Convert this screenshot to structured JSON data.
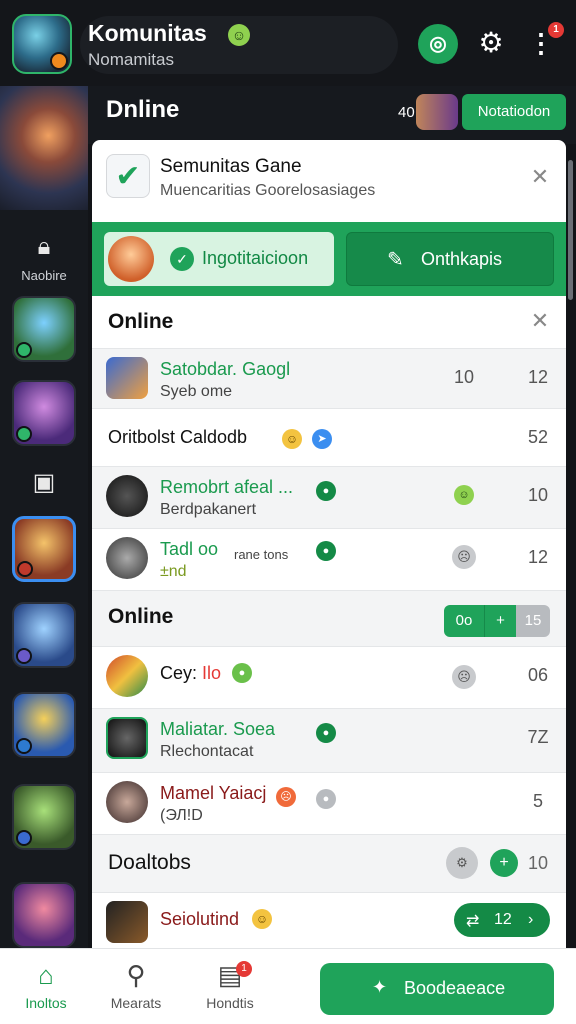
{
  "header": {
    "title": "Komunitas",
    "subtitle": "Nomamitas",
    "smile_icon": "smile-icon",
    "more_badge": "1"
  },
  "online_strip": {
    "label": "Dnline",
    "count": "40",
    "button": "Notatiodon"
  },
  "sidebar": {
    "label1": "Naobire"
  },
  "community_card": {
    "title": "Semunitas Gane",
    "subtitle": "Muencaritias Goorelosasiages"
  },
  "tabs": {
    "left": "Ingotitaicioon",
    "right": "Onthkapis"
  },
  "section1": {
    "title": "Online"
  },
  "rows1": [
    {
      "name": "Satobdar. Gaogl",
      "sub": "Syeb ome",
      "c1": "10",
      "c2": "12"
    },
    {
      "name": "Oritbolst Caldodb",
      "c2": "52"
    },
    {
      "name": "Remobrt afeal ...",
      "sub": "Berdpakanert",
      "c2": "10"
    },
    {
      "name": "Tadl oo",
      "sub": "±nd",
      "extra": "rane tons",
      "c2": "12"
    }
  ],
  "section2": {
    "title": "Online",
    "seg": [
      "0o",
      "+",
      "15"
    ]
  },
  "rows2": [
    {
      "name": "Cey:",
      "name_accent": "Ilo",
      "c2": "06"
    },
    {
      "name": "Maliatar. Soea",
      "sub": "Rlechontacat",
      "c2": "7Z"
    },
    {
      "name": "Mamel Yaiacj",
      "sub": "(ЭЛ!D",
      "c2": "5"
    }
  ],
  "section3": {
    "title": "Doaltobs",
    "count": "10"
  },
  "rows3": [
    {
      "name": "Seiolutind",
      "btn_count": "12"
    }
  ],
  "bottom_nav": {
    "items": [
      {
        "label": "Inoltos"
      },
      {
        "label": "Mearats"
      },
      {
        "label": "Hondtis",
        "badge": "1"
      }
    ],
    "cta": "Boodeaeace"
  }
}
